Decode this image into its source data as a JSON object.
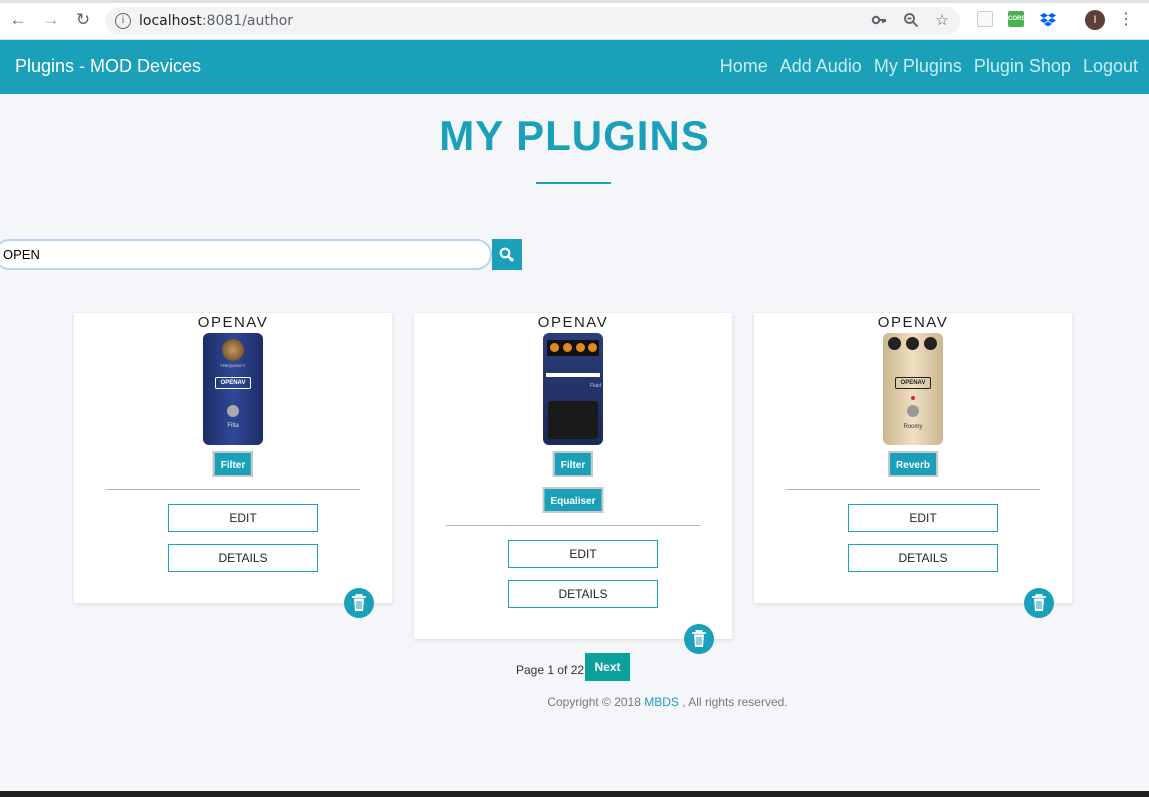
{
  "browser": {
    "url_host": "localhost",
    "url_rest": ":8081/author",
    "info_glyph": "i",
    "back_icon": "arrow-left-icon",
    "forward_icon": "arrow-right-icon",
    "reload_icon": "reload-icon",
    "avatar_initial": "I",
    "extensions": [
      "grid-extension-icon",
      "cors-extension-icon",
      "dropbox-extension-icon"
    ],
    "cors_label": "CORS"
  },
  "navbar": {
    "brand": "Plugins - MOD Devices",
    "links": [
      "Home",
      "Add Audio",
      "My Plugins",
      "Plugin Shop",
      "Logout"
    ]
  },
  "page": {
    "title": "MY PLUGINS"
  },
  "search": {
    "value": "OPEN"
  },
  "cards": [
    {
      "brand": "OPENAV",
      "pedal_label": "OPENAV",
      "pedal_name": "Filta",
      "pedal_knob": "FREQUENCY",
      "tags": [
        "Filter"
      ],
      "edit": "EDIT",
      "details": "DETAILS"
    },
    {
      "brand": "OPENAV",
      "pedal_name": "Fluid",
      "tags": [
        "Filter",
        "Equaliser"
      ],
      "edit": "EDIT",
      "details": "DETAILS"
    },
    {
      "brand": "OPENAV",
      "pedal_label": "OPENAV",
      "pedal_name": "Roomy",
      "tags": [
        "Reverb"
      ],
      "edit": "EDIT",
      "details": "DETAILS"
    }
  ],
  "pagination": {
    "text": "Page 1 of 22",
    "next": "Next"
  },
  "footer": {
    "prefix": "Copyright © 2018",
    "link": "MBDS",
    "suffix": ", All rights reserved."
  },
  "colors": {
    "accent": "#1aa0b9",
    "next_button": "#0aa09c",
    "background": "#f5f6fa"
  }
}
